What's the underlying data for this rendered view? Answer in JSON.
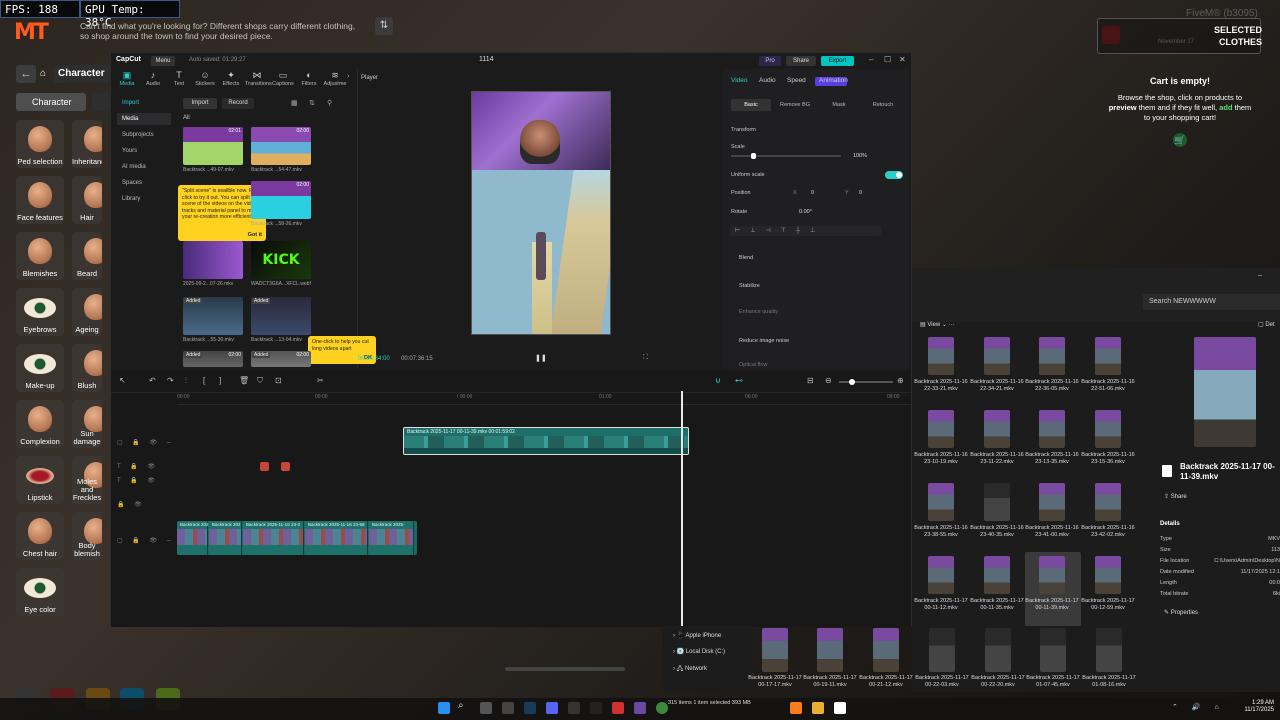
{
  "overlay": {
    "fps": "FPS: 188",
    "gpu": "GPU Temp: 38°C",
    "logo": "MT",
    "hint": "Can't find what you're looking for? Different shops carry different clothing, so shop around the town to find your desired piece.",
    "fivem": "FiveM® (b3095)"
  },
  "character_panel": {
    "header": "Character",
    "tab": "Character",
    "tiles": [
      {
        "label": "Ped selection"
      },
      {
        "label": "Inheritance"
      },
      {
        "label": "Face features"
      },
      {
        "label": "Hair"
      },
      {
        "label": "Blemishes"
      },
      {
        "label": "Beard"
      },
      {
        "label": "Eyebrows"
      },
      {
        "label": "Ageing"
      },
      {
        "label": "Make-up"
      },
      {
        "label": "Blush"
      },
      {
        "label": "Complexion"
      },
      {
        "label": "Sun damage"
      },
      {
        "label": "Lipstick"
      },
      {
        "label": "Moles and Freckles"
      },
      {
        "label": "Chest hair"
      },
      {
        "label": "Body blemish"
      },
      {
        "label": "Eye color"
      }
    ]
  },
  "shop": {
    "selected_title_1": "SELECTED",
    "selected_title_2": "CLOTHES",
    "date_ghost": "November 17",
    "cart_empty": "Cart is empty!",
    "cart_desc_1": "Browse the shop, click on products to",
    "cart_desc_2": "preview",
    "cart_desc_3": "them and if they fit well,",
    "cart_desc_4": "add",
    "cart_desc_5": "them to your shopping cart!",
    "accent_green": "#5fdc7a"
  },
  "capcut": {
    "app_name": "CapCut",
    "menu": "Menu",
    "autosave": "Auto saved: 01:29:27",
    "window_title": "1114",
    "pro": "Pro",
    "share": "Share",
    "export": "Export",
    "toolbar": [
      {
        "label": "Media",
        "icon": "media-icon"
      },
      {
        "label": "Audio",
        "icon": "audio-icon"
      },
      {
        "label": "Text",
        "icon": "text-icon"
      },
      {
        "label": "Stickers",
        "icon": "sticker-icon"
      },
      {
        "label": "Effects",
        "icon": "effects-icon"
      },
      {
        "label": "Transitions",
        "icon": "transitions-icon"
      },
      {
        "label": "Captions",
        "icon": "captions-icon"
      },
      {
        "label": "Filters",
        "icon": "filters-icon"
      },
      {
        "label": "Adjustme",
        "icon": "adjust-icon"
      }
    ],
    "leftnav": [
      "Import",
      "Media",
      "Subprojects",
      "Yours",
      "AI media",
      "Spaces",
      "Library"
    ],
    "import_btn": "Import",
    "record_btn": "Record",
    "all_label": "All",
    "media": [
      {
        "name": "Backtrack ...49-07.mkv",
        "dur": "02:01",
        "added": ""
      },
      {
        "name": "Backtrack ...54-47.mkv",
        "dur": "02:00",
        "added": ""
      },
      {
        "name": "",
        "dur": "",
        "added": ""
      },
      {
        "name": "Backtrack ...58-26.mkv",
        "dur": "02:00",
        "added": ""
      },
      {
        "name": "2025-09-2...07-26.mkv",
        "dur": "",
        "added": ""
      },
      {
        "name": "WADCT3G6A...XFCL.webf",
        "dur": "",
        "added": ""
      },
      {
        "name": "Backtrack ...55-30.mkv",
        "dur": "",
        "added": "Added"
      },
      {
        "name": "Backtrack ...13-04.mkv",
        "dur": "",
        "added": "Added"
      },
      {
        "name": "",
        "dur": "02:00",
        "added": "Added"
      },
      {
        "name": "",
        "dur": "02:00",
        "added": "Added"
      }
    ],
    "tooltip_split": "\"Split scene\" is availble now. Right click to try it out. You can split scene of the videos on the video tracks and material panel to make your re-creation more efficient.",
    "tooltip_split_btn": "Got it",
    "tooltip_oneclick": "One-click to help you cut long videos apart",
    "tooltip_oneclick_btn": "OK",
    "player_title": "Player",
    "player_time": "00:04:34:00",
    "player_total": "00:07:36:15",
    "right_tabs": [
      "Video",
      "Audio",
      "Speed",
      "Animation"
    ],
    "right_subtabs": [
      "Basic",
      "Remove BG",
      "Mask",
      "Retouch"
    ],
    "transform": "Transform",
    "scale": "Scale",
    "scale_val": "100%",
    "uniform_scale": "Uniform scale",
    "position": "Position",
    "pos_x_label": "X",
    "pos_x": "0",
    "pos_y_label": "Y",
    "pos_y": "0",
    "rotate": "Rotate",
    "rotate_val": "0.00°",
    "blend": "Blend",
    "stabilize": "Stabilize",
    "enhance_quality": "Enhance quality",
    "reduce_noise": "Reduce image noise",
    "optical_flow": "Optical flow",
    "timeline_ticks": [
      "00:00",
      "00:00",
      "I 00:00",
      "01:00",
      "06:00",
      "09:00"
    ],
    "main_clip_title": "Backtrack 2025-11-17 00-11-39.mkv   00:01:59:02",
    "bottom_clip_titles": [
      "Backtrack 202",
      "Backtrack 202",
      "Backtrack 2025-11-16 23-3",
      "Backtrack 2025-11-16 23-59",
      "Backtrack 2025-"
    ]
  },
  "explorer": {
    "search": "Search NEWWWWW",
    "view": "View",
    "files": [
      {
        "name": "Backtrack 2025-11-16 22-33-21.mkv"
      },
      {
        "name": "Backtrack 2025-11-16 22-34-21.mkv"
      },
      {
        "name": "Backtrack 2025-11-16 22-36-05.mkv"
      },
      {
        "name": "Backtrack 2025-11-16 22-51-06.mkv"
      },
      {
        "name": "Backtrack 2025-11-16 23-10-19.mkv"
      },
      {
        "name": "Backtrack 2025-11-16 23-11-22.mkv"
      },
      {
        "name": "Backtrack 2025-11-16 23-13-35.mkv"
      },
      {
        "name": "Backtrack 2025-11-16 23-15-36.mkv"
      },
      {
        "name": "Backtrack 2025-11-16 23-38-55.mkv"
      },
      {
        "name": "Backtrack 2025-11-16 23-40-35.mkv"
      },
      {
        "name": "Backtrack 2025-11-16 23-41-00.mkv"
      },
      {
        "name": "Backtrack 2025-11-16 23-42-02.mkv"
      },
      {
        "name": "Backtrack 2025-11-17 00-11-12.mkv"
      },
      {
        "name": "Backtrack 2025-11-17 00-11-35.mkv"
      },
      {
        "name": "Backtrack 2025-11-17 00-11-39.mkv"
      },
      {
        "name": "Backtrack 2025-11-17 00-12-59.mkv"
      }
    ],
    "bottom_files": [
      {
        "name": "Backtrack 2025-11-17 00-17-17.mkv"
      },
      {
        "name": "Backtrack 2025-11-17 00-19-11.mkv"
      },
      {
        "name": "Backtrack 2025-11-17 00-21-12.mkv"
      },
      {
        "name": "Backtrack 2025-11-17 00-22-03.mkv"
      },
      {
        "name": "Backtrack 2025-11-17 00-22-20.mkv"
      },
      {
        "name": "Backtrack 2025-11-17 01-07-45.mkv"
      },
      {
        "name": "Backtrack 2025-11-17 01-08-16.mkv"
      }
    ],
    "tree": [
      "Apple iPhone",
      "Local Disk (C:)",
      "Network"
    ],
    "details_label": "Details",
    "details_title": "Backtrack 2025-11-17 00-11-39.mkv",
    "share": "Share",
    "props": [
      {
        "k": "Type",
        "v": "MKV"
      },
      {
        "k": "Size",
        "v": "113"
      },
      {
        "k": "File location",
        "v": "C:\\Users\\Admin\\Desktop\\N"
      },
      {
        "k": "Date modified",
        "v": "11/17/2025 12:1"
      },
      {
        "k": "Length",
        "v": "00:0"
      },
      {
        "k": "Total bitrate",
        "v": "6ki"
      }
    ],
    "properties_btn": "Properties"
  },
  "taskbar": {
    "status": "315 items   1 item selected   393 MB",
    "time": "1:29 AM",
    "date": "11/17/2025"
  }
}
